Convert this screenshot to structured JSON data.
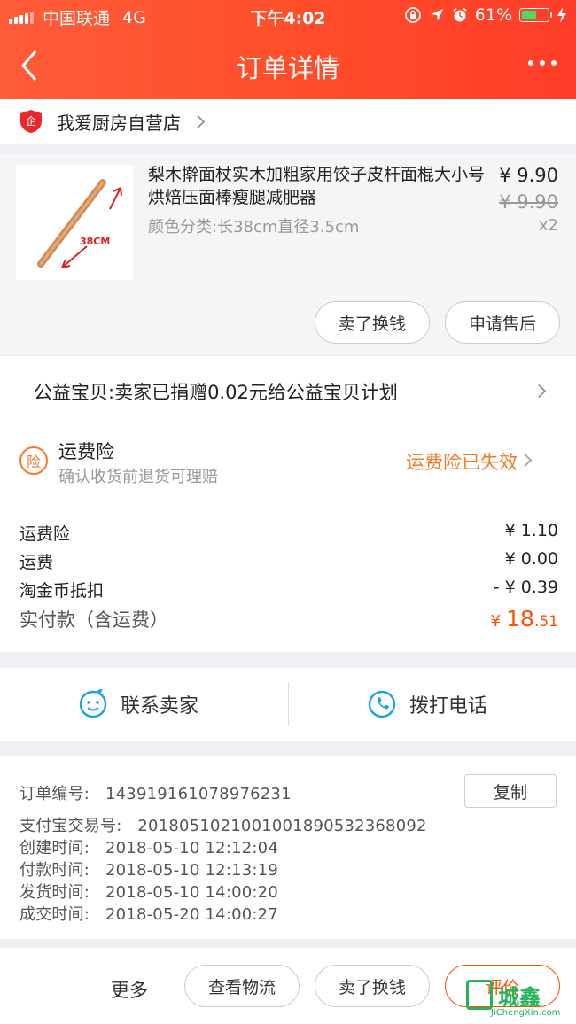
{
  "status_bar": {
    "carrier": "中国联通",
    "network": "4G",
    "time": "下午4:02",
    "battery": "61%",
    "battery_level": 0.61
  },
  "navbar": {
    "title": "订单详情"
  },
  "shop": {
    "name": "我爱厨房自营店",
    "logo_text": "企"
  },
  "product": {
    "name": "梨木擀面杖实木加粗家用饺子皮杆面棍大小号烘焙压面棒瘦腿减肥器",
    "sku": "颜色分类:长38cm直径3.5cm",
    "price": "¥ 9.90",
    "original_price": "¥ 9.90",
    "quantity": "x2",
    "image_label": "38CM",
    "buttons": {
      "sell": "卖了换钱",
      "after_sale": "申请售后"
    }
  },
  "charity": {
    "text": "公益宝贝:卖家已捐赠0.02元给公益宝贝计划"
  },
  "insurance": {
    "icon_text": "险",
    "title": "运费险",
    "subtitle": "确认收货前退货可理赔",
    "status": "运费险已失效"
  },
  "costs": {
    "rows": [
      {
        "label": "运费险",
        "value": "¥ 1.10"
      },
      {
        "label": "运费",
        "value": "¥ 0.00"
      },
      {
        "label": "淘金币抵扣",
        "value": "- ¥ 0.39"
      }
    ],
    "total_label": "实付款（含运费）",
    "total_currency": "¥",
    "total_int": "18",
    "total_dec": ".51"
  },
  "contact": {
    "seller": "联系卖家",
    "phone": "拨打电话"
  },
  "order_info": {
    "order_no_label": "订单编号:",
    "order_no": "143919161078976231",
    "copy": "复制",
    "alipay_label": "支付宝交易号:",
    "alipay_no": "2018051021001001890532368092",
    "created_label": "创建时间:",
    "created": "2018-05-10 12:12:04",
    "paid_label": "付款时间:",
    "paid": "2018-05-10 12:13:19",
    "shipped_label": "发货时间:",
    "shipped": "2018-05-10 14:00:20",
    "done_label": "成交时间:",
    "done": "2018-05-20 14:00:27"
  },
  "footer": {
    "more": "更多",
    "logistics": "查看物流",
    "sell": "卖了换钱",
    "review": "评价"
  },
  "watermark": {
    "text": "城鑫",
    "url": "JiChengXin.com"
  },
  "colors": {
    "header": "#ff4e2a",
    "accent": "#ff5000",
    "insurance": "#f47a2b",
    "contact_icon": "#1aa3e8"
  }
}
